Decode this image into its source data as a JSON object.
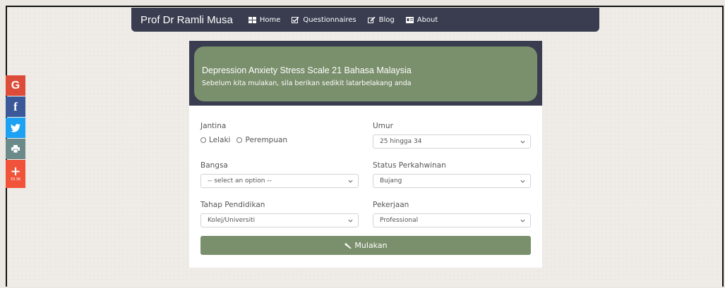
{
  "navbar": {
    "brand": "Prof Dr Ramli Musa",
    "items": [
      {
        "label": "Home",
        "icon": "home-grid-icon"
      },
      {
        "label": "Questionnaires",
        "icon": "checkbox-icon"
      },
      {
        "label": "Blog",
        "icon": "edit-icon"
      },
      {
        "label": "About",
        "icon": "id-card-icon"
      }
    ]
  },
  "social": {
    "google": "G",
    "facebook": "f",
    "share_count": "33.3K"
  },
  "header": {
    "title": "Depression Anxiety Stress Scale 21 Bahasa Malaysia",
    "subtitle": "Sebelum kita mulakan, sila berikan sedikit latarbelakang anda"
  },
  "form": {
    "gender": {
      "label": "Jantina",
      "options": [
        "Lelaki",
        "Perempuan"
      ]
    },
    "age": {
      "label": "Umur",
      "value": "25 hingga 34"
    },
    "race": {
      "label": "Bangsa",
      "value": "-- select an option --"
    },
    "marital": {
      "label": "Status Perkahwinan",
      "value": "Bujang"
    },
    "education": {
      "label": "Tahap Pendidikan",
      "value": "Kolej/Universiti"
    },
    "job": {
      "label": "Pekerjaan",
      "value": "Professional"
    },
    "submit_label": "Mulakan"
  },
  "colors": {
    "navbar": "#393d4f",
    "accent": "#7a8f6c",
    "google": "#dd4b39",
    "facebook": "#3b5998",
    "twitter": "#1da1f2",
    "print": "#6d8a8a",
    "more": "#f0533a"
  }
}
